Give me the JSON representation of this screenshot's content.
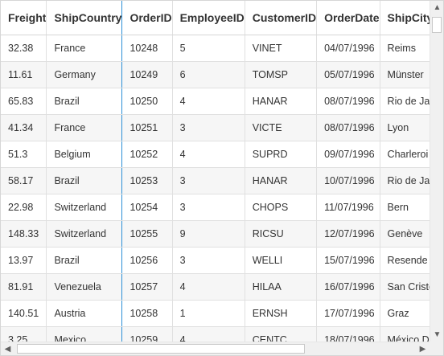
{
  "columns": [
    "Freight",
    "ShipCountry",
    "OrderID",
    "EmployeeID",
    "CustomerID",
    "OrderDate",
    "ShipCity"
  ],
  "rows": [
    [
      "32.38",
      "France",
      "10248",
      "5",
      "VINET",
      "04/07/1996",
      "Reims"
    ],
    [
      "11.61",
      "Germany",
      "10249",
      "6",
      "TOMSP",
      "05/07/1996",
      "Münster"
    ],
    [
      "65.83",
      "Brazil",
      "10250",
      "4",
      "HANAR",
      "08/07/1996",
      "Rio de Janeiro"
    ],
    [
      "41.34",
      "France",
      "10251",
      "3",
      "VICTE",
      "08/07/1996",
      "Lyon"
    ],
    [
      "51.3",
      "Belgium",
      "10252",
      "4",
      "SUPRD",
      "09/07/1996",
      "Charleroi"
    ],
    [
      "58.17",
      "Brazil",
      "10253",
      "3",
      "HANAR",
      "10/07/1996",
      "Rio de Janeiro"
    ],
    [
      "22.98",
      "Switzerland",
      "10254",
      "3",
      "CHOPS",
      "11/07/1996",
      "Bern"
    ],
    [
      "148.33",
      "Switzerland",
      "10255",
      "9",
      "RICSU",
      "12/07/1996",
      "Genève"
    ],
    [
      "13.97",
      "Brazil",
      "10256",
      "3",
      "WELLI",
      "15/07/1996",
      "Resende"
    ],
    [
      "81.91",
      "Venezuela",
      "10257",
      "4",
      "HILAA",
      "16/07/1996",
      "San Cristóbal"
    ],
    [
      "140.51",
      "Austria",
      "10258",
      "1",
      "ERNSH",
      "17/07/1996",
      "Graz"
    ],
    [
      "3.25",
      "Mexico",
      "10259",
      "4",
      "CENTC",
      "18/07/1996",
      "México D.F."
    ]
  ],
  "scrollbar": {
    "up_icon": "chevron-up-icon",
    "down_icon": "chevron-down-icon",
    "left_icon": "chevron-left-icon",
    "right_icon": "chevron-right-icon"
  },
  "colors": {
    "frozen_divider": "#2b8fd6",
    "alt_row": "#f6f6f6",
    "border": "#e0e0e0"
  }
}
